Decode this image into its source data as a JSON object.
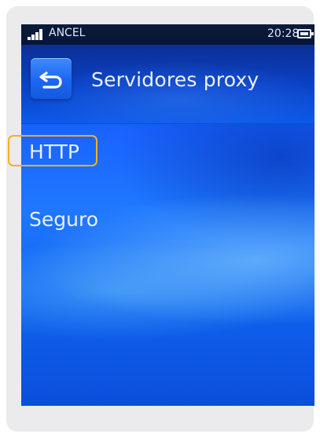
{
  "statusbar": {
    "carrier": "ANCEL",
    "time": "20:28",
    "signal_icon": "signal-strength-icon",
    "battery_icon": "battery-icon"
  },
  "header": {
    "back_icon": "back-arrow-icon",
    "title": "Servidores proxy"
  },
  "list": {
    "items": [
      {
        "label": "HTTP",
        "selected": true
      },
      {
        "label": "Seguro",
        "selected": false
      }
    ]
  },
  "colors": {
    "highlight": "#f2b21f",
    "screen_blue": "#1f78ff",
    "text": "#e7f0ff"
  }
}
